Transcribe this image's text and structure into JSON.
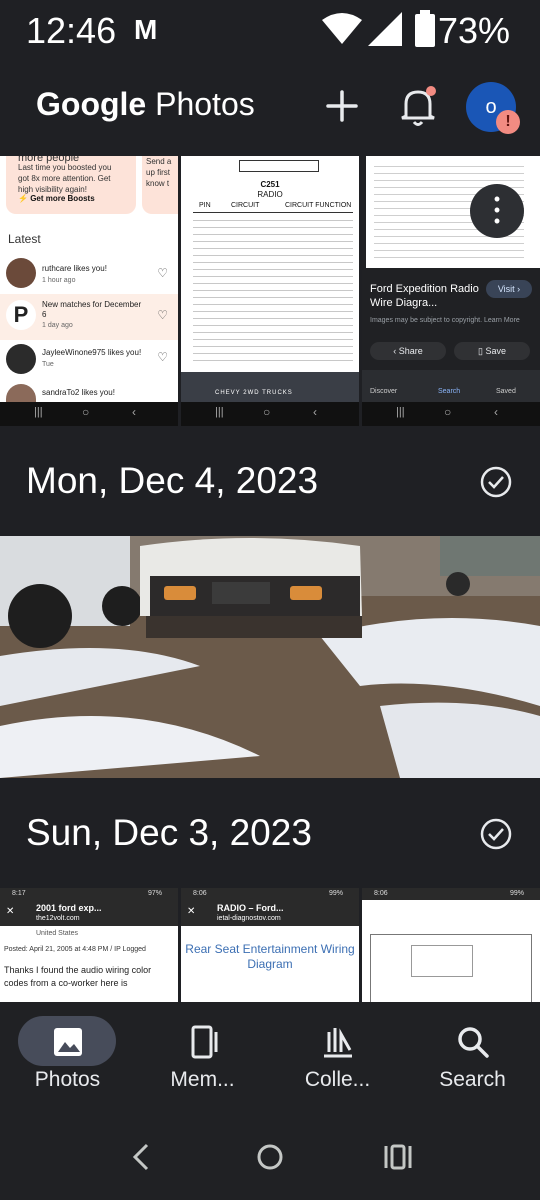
{
  "status_bar": {
    "time": "12:46",
    "mail_glyph": "M",
    "battery_pct": "73%"
  },
  "app_bar": {
    "brand_google": "Google",
    "brand_photos": "Photos",
    "avatar_initial": "o",
    "avatar_alert": "!"
  },
  "thumb1": {
    "title": "more people",
    "line1": "Last time you boosted you",
    "line2": "got 8x more attention. Get",
    "line3": "high visibility again!",
    "boost": "Get more Boosts",
    "side1": "Send a",
    "side2": "up first",
    "side3": "know t",
    "latest": "Latest",
    "items": [
      {
        "text": "ruthcare likes you!",
        "time": "1 hour ago"
      },
      {
        "text": "New matches for December 6",
        "time": "1 day ago"
      },
      {
        "text": "JayleeWinone975 likes you!",
        "time": "Tue"
      },
      {
        "text": "sandraTo2 likes you!",
        "time": ""
      }
    ]
  },
  "thumb2": {
    "header": "C251",
    "sub": "RADIO",
    "cols": [
      "PIN",
      "CIRCUIT",
      "CIRCUIT FUNCTION"
    ],
    "caption": "CHEVY 2WD TRUCKS"
  },
  "thumb3": {
    "title": "Ford Expedition Radio Wire Diagra...",
    "visit": "Visit",
    "note": "Images may be subject to copyright. Learn More",
    "share": "Share",
    "save": "Save",
    "nav": [
      "Discover",
      "Search",
      "Saved"
    ]
  },
  "sections": [
    {
      "date": "Mon, Dec 4, 2023"
    },
    {
      "date": "Sun, Dec 3, 2023"
    }
  ],
  "row2": {
    "a_title": "2001 ford exp...",
    "a_host": "the12volt.com",
    "a_status": "United States",
    "a_posted": "Posted: April 21, 2005 at 4:48 PM / IP Logged",
    "a_body": "Thanks I found the audio wiring color codes from a co-worker here is",
    "b_title": "RADIO – Ford...",
    "b_host": "ietal-diagnostov.com",
    "b_body": "Rear Seat Entertainment Wiring Diagram",
    "time_a": "8:17",
    "time_b": "8:06",
    "time_c": "8:06",
    "pct_a": "97%",
    "pct_b": "99%",
    "pct_c": "99%"
  },
  "bottom_nav": [
    {
      "label": "Photos",
      "icon": "photo-icon",
      "active": true
    },
    {
      "label": "Mem...",
      "icon": "memories-icon",
      "active": false
    },
    {
      "label": "Colle...",
      "icon": "collections-icon",
      "active": false
    },
    {
      "label": "Search",
      "icon": "search-icon",
      "active": false
    }
  ],
  "colors": {
    "background": "#1f2024",
    "active_pill": "#474c5a",
    "avatar": "#1a56b6",
    "alert": "#f28b82"
  }
}
